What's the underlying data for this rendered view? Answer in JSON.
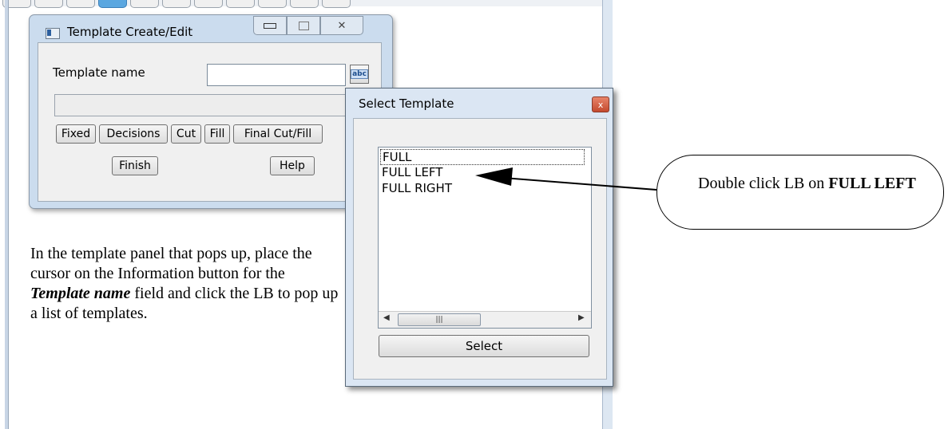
{
  "template_window": {
    "title": "Template Create/Edit",
    "field_label": "Template name",
    "template_name_value": "",
    "info_button_label": "abc",
    "buttons": [
      "Fixed",
      "Decisions",
      "Cut",
      "Fill",
      "Final Cut/Fill"
    ],
    "finish_label": "Finish",
    "help_label": "Help"
  },
  "instruction_text": {
    "part1": "In the template panel that pops up, place the cursor on the Information button for the ",
    "emphasis": "Template name",
    "part2": " field and click the LB to pop up a list of templates."
  },
  "select_dialog": {
    "title": "Select Template",
    "close_glyph": "x",
    "items": [
      "FULL",
      "FULL LEFT",
      "FULL RIGHT"
    ],
    "selected_index": 0,
    "select_label": "Select"
  },
  "callout": {
    "prefix": "Double click LB on ",
    "bold": "FULL LEFT"
  }
}
